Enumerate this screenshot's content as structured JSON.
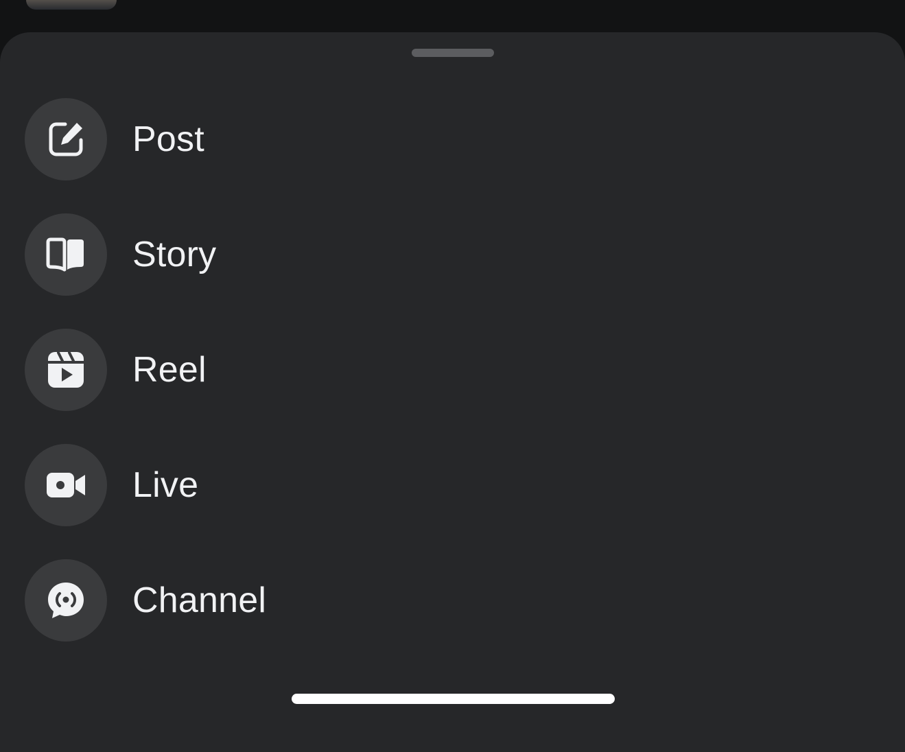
{
  "menu": {
    "items": [
      {
        "label": "Post",
        "icon": "edit-square-icon"
      },
      {
        "label": "Story",
        "icon": "open-book-icon"
      },
      {
        "label": "Reel",
        "icon": "reel-icon"
      },
      {
        "label": "Live",
        "icon": "video-camera-icon"
      },
      {
        "label": "Channel",
        "icon": "broadcast-chat-icon"
      }
    ]
  },
  "colors": {
    "backdrop": "#121314",
    "sheet": "#262729",
    "icon_circle": "#3a3b3d",
    "text": "#f1f2f4",
    "icon": "#f1f2f4"
  }
}
